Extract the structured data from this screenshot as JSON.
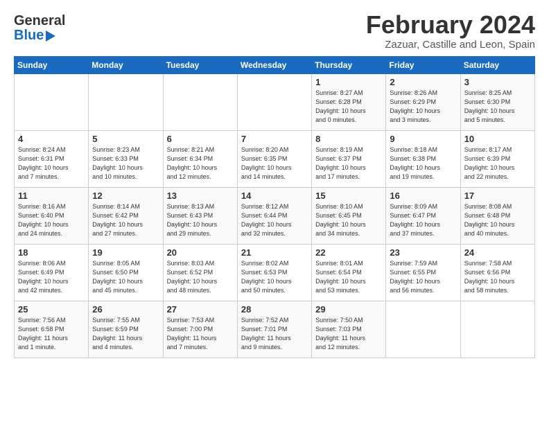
{
  "header": {
    "logo_line1": "General",
    "logo_line2": "Blue",
    "month_year": "February 2024",
    "location": "Zazuar, Castille and Leon, Spain"
  },
  "weekdays": [
    "Sunday",
    "Monday",
    "Tuesday",
    "Wednesday",
    "Thursday",
    "Friday",
    "Saturday"
  ],
  "weeks": [
    [
      {
        "day": "",
        "info": ""
      },
      {
        "day": "",
        "info": ""
      },
      {
        "day": "",
        "info": ""
      },
      {
        "day": "",
        "info": ""
      },
      {
        "day": "1",
        "info": "Sunrise: 8:27 AM\nSunset: 6:28 PM\nDaylight: 10 hours\nand 0 minutes."
      },
      {
        "day": "2",
        "info": "Sunrise: 8:26 AM\nSunset: 6:29 PM\nDaylight: 10 hours\nand 3 minutes."
      },
      {
        "day": "3",
        "info": "Sunrise: 8:25 AM\nSunset: 6:30 PM\nDaylight: 10 hours\nand 5 minutes."
      }
    ],
    [
      {
        "day": "4",
        "info": "Sunrise: 8:24 AM\nSunset: 6:31 PM\nDaylight: 10 hours\nand 7 minutes."
      },
      {
        "day": "5",
        "info": "Sunrise: 8:23 AM\nSunset: 6:33 PM\nDaylight: 10 hours\nand 10 minutes."
      },
      {
        "day": "6",
        "info": "Sunrise: 8:21 AM\nSunset: 6:34 PM\nDaylight: 10 hours\nand 12 minutes."
      },
      {
        "day": "7",
        "info": "Sunrise: 8:20 AM\nSunset: 6:35 PM\nDaylight: 10 hours\nand 14 minutes."
      },
      {
        "day": "8",
        "info": "Sunrise: 8:19 AM\nSunset: 6:37 PM\nDaylight: 10 hours\nand 17 minutes."
      },
      {
        "day": "9",
        "info": "Sunrise: 8:18 AM\nSunset: 6:38 PM\nDaylight: 10 hours\nand 19 minutes."
      },
      {
        "day": "10",
        "info": "Sunrise: 8:17 AM\nSunset: 6:39 PM\nDaylight: 10 hours\nand 22 minutes."
      }
    ],
    [
      {
        "day": "11",
        "info": "Sunrise: 8:16 AM\nSunset: 6:40 PM\nDaylight: 10 hours\nand 24 minutes."
      },
      {
        "day": "12",
        "info": "Sunrise: 8:14 AM\nSunset: 6:42 PM\nDaylight: 10 hours\nand 27 minutes."
      },
      {
        "day": "13",
        "info": "Sunrise: 8:13 AM\nSunset: 6:43 PM\nDaylight: 10 hours\nand 29 minutes."
      },
      {
        "day": "14",
        "info": "Sunrise: 8:12 AM\nSunset: 6:44 PM\nDaylight: 10 hours\nand 32 minutes."
      },
      {
        "day": "15",
        "info": "Sunrise: 8:10 AM\nSunset: 6:45 PM\nDaylight: 10 hours\nand 34 minutes."
      },
      {
        "day": "16",
        "info": "Sunrise: 8:09 AM\nSunset: 6:47 PM\nDaylight: 10 hours\nand 37 minutes."
      },
      {
        "day": "17",
        "info": "Sunrise: 8:08 AM\nSunset: 6:48 PM\nDaylight: 10 hours\nand 40 minutes."
      }
    ],
    [
      {
        "day": "18",
        "info": "Sunrise: 8:06 AM\nSunset: 6:49 PM\nDaylight: 10 hours\nand 42 minutes."
      },
      {
        "day": "19",
        "info": "Sunrise: 8:05 AM\nSunset: 6:50 PM\nDaylight: 10 hours\nand 45 minutes."
      },
      {
        "day": "20",
        "info": "Sunrise: 8:03 AM\nSunset: 6:52 PM\nDaylight: 10 hours\nand 48 minutes."
      },
      {
        "day": "21",
        "info": "Sunrise: 8:02 AM\nSunset: 6:53 PM\nDaylight: 10 hours\nand 50 minutes."
      },
      {
        "day": "22",
        "info": "Sunrise: 8:01 AM\nSunset: 6:54 PM\nDaylight: 10 hours\nand 53 minutes."
      },
      {
        "day": "23",
        "info": "Sunrise: 7:59 AM\nSunset: 6:55 PM\nDaylight: 10 hours\nand 56 minutes."
      },
      {
        "day": "24",
        "info": "Sunrise: 7:58 AM\nSunset: 6:56 PM\nDaylight: 10 hours\nand 58 minutes."
      }
    ],
    [
      {
        "day": "25",
        "info": "Sunrise: 7:56 AM\nSunset: 6:58 PM\nDaylight: 11 hours\nand 1 minute."
      },
      {
        "day": "26",
        "info": "Sunrise: 7:55 AM\nSunset: 6:59 PM\nDaylight: 11 hours\nand 4 minutes."
      },
      {
        "day": "27",
        "info": "Sunrise: 7:53 AM\nSunset: 7:00 PM\nDaylight: 11 hours\nand 7 minutes."
      },
      {
        "day": "28",
        "info": "Sunrise: 7:52 AM\nSunset: 7:01 PM\nDaylight: 11 hours\nand 9 minutes."
      },
      {
        "day": "29",
        "info": "Sunrise: 7:50 AM\nSunset: 7:03 PM\nDaylight: 11 hours\nand 12 minutes."
      },
      {
        "day": "",
        "info": ""
      },
      {
        "day": "",
        "info": ""
      }
    ]
  ]
}
